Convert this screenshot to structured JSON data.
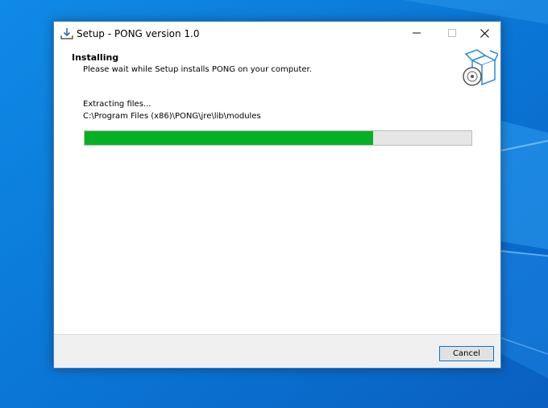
{
  "window": {
    "title": "Setup - PONG version 1.0"
  },
  "header": {
    "heading": "Installing",
    "subheading": "Please wait while Setup installs PONG on your computer."
  },
  "progress": {
    "status": "Extracting files...",
    "current_path": "C:\\Program Files (x86)\\PONG\\jre\\lib\\modules",
    "fraction": 0.745,
    "fill_color": "#06b025"
  },
  "footer": {
    "cancel_label": "Cancel"
  },
  "colors": {
    "desktop_blue": "#0a78d7",
    "accent_border": "#0078d7"
  },
  "icons": {
    "app": "download-tray-icon",
    "setup": "package-box-disc-icon",
    "minimize": "minimize-icon",
    "maximize": "maximize-icon",
    "close": "close-icon"
  }
}
